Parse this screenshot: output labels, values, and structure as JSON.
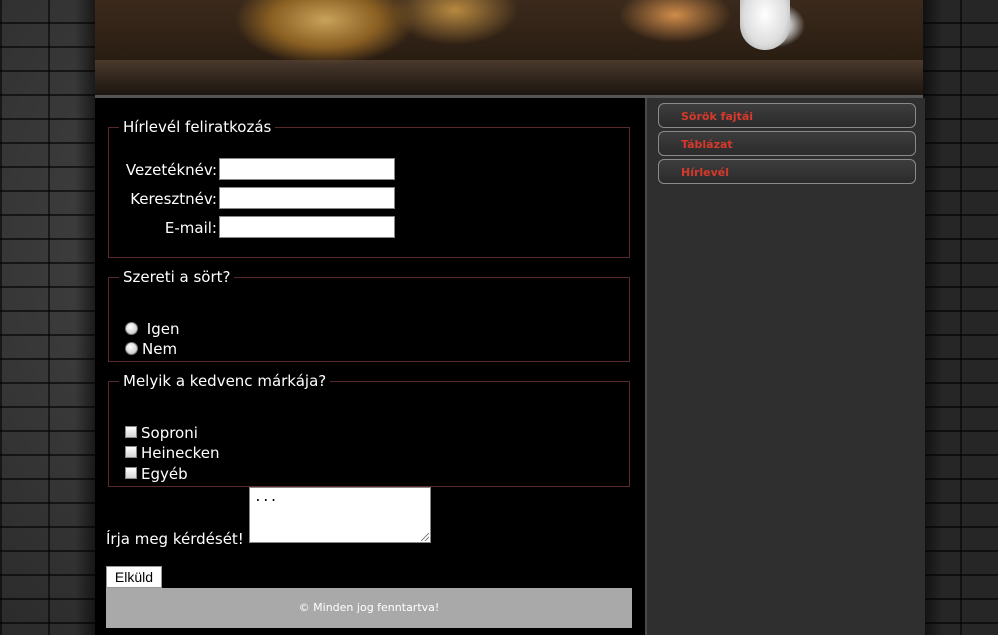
{
  "newsletter": {
    "legend": "Hírlevél feliratkozás",
    "fields": [
      {
        "label": "Vezetéknév:",
        "value": ""
      },
      {
        "label": "Keresztnév:",
        "value": ""
      },
      {
        "label": "E-mail:",
        "value": ""
      }
    ]
  },
  "like_beer": {
    "legend": "Szereti a sört?",
    "options": [
      " Igen",
      "Nem"
    ]
  },
  "brands": {
    "legend": "Melyik a kedvenc márkája?",
    "options": [
      "Soproni",
      "Heinecken",
      "Egyéb"
    ]
  },
  "question": {
    "label": "Írja meg kérdését!",
    "value": "..."
  },
  "submit_label": "Elküld",
  "footer_text": "© Minden jog fenntartva!",
  "nav": {
    "items": [
      "Sörök fajtái",
      "Táblázat",
      "Hírlevél"
    ]
  },
  "colors": {
    "nav_text": "#d6392b",
    "sidebar_bg": "#2f2f2f",
    "footer_bg": "#a9a9a9"
  }
}
